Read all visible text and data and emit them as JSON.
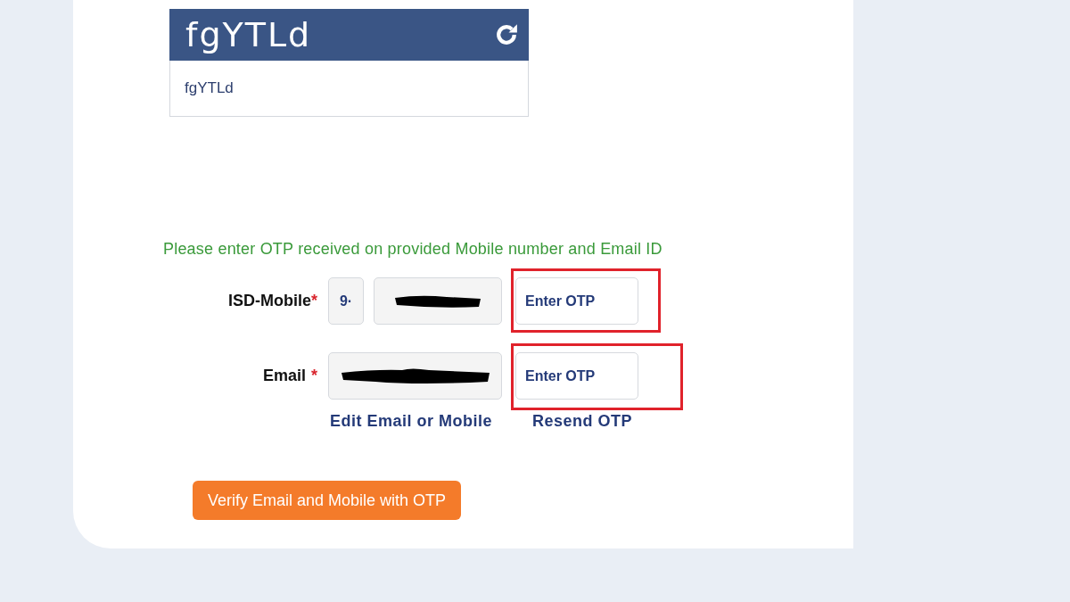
{
  "captcha": {
    "image_text": "fgYTLd",
    "input_value": "fgYTLd"
  },
  "message": "Please enter OTP received on provided Mobile number and Email ID",
  "rows": [
    {
      "kind": "mobile",
      "label": "ISD-Mobile",
      "required_mark": "*",
      "isd_value": "9·",
      "value_redacted": true,
      "otp_placeholder": "Enter OTP",
      "highlighted": true
    },
    {
      "kind": "email",
      "label": "Email",
      "required_mark": "*",
      "value_redacted": true,
      "otp_placeholder": "Enter OTP",
      "highlighted": true
    }
  ],
  "links": [
    "Edit Email or Mobile",
    "Resend OTP"
  ],
  "button": "Verify Email and Mobile with OTP"
}
